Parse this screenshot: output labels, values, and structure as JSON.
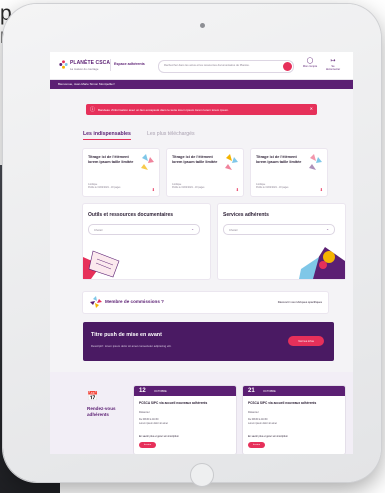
{
  "background_text": [
    "p",
    "n"
  ],
  "header": {
    "brand_name": "PLANÈTE CSCA",
    "brand_tagline": "La maison du courtage",
    "espace_label": "Espace adhérents",
    "search_placeholder": "Rechercher dans les actus et les ressources documentaires de Planète.",
    "account_label": "Mon compte",
    "logout_label": "Se déconnecter"
  },
  "welcome_text": "Bienvenue, Jean-Marie Simon Montpellier!",
  "alert_text": "Bandeau d'information avec un lien encapsulé dans le texte lorem ipsum lorem lorem lorem ipsum.",
  "tabs": [
    "Les indispensables",
    "Les plus téléchargés"
  ],
  "cards": [
    {
      "title": "Titrage ici de l'élément lorem ipsum taille limitée",
      "meta1": "Juridique",
      "meta2": "Publié le 01/02/2021 - 18 pages"
    },
    {
      "title": "Titrage ici de l'élément lorem ipsum taille limitée",
      "meta1": "Juridique",
      "meta2": "Publié le 01/02/2021 - 18 pages"
    },
    {
      "title": "Titrage ici de l'élément lorem ipsum taille limitée",
      "meta1": "Juridique",
      "meta2": "Publié le 01/02/2021 - 18 pages"
    }
  ],
  "panels": [
    {
      "title": "Outils et ressources documentaires",
      "select": "Choisir"
    },
    {
      "title": "Services adhérents",
      "select": "Choisir"
    }
  ],
  "commission": {
    "title": "Membre de commissions ?",
    "link": "Découvrir vos rubriques spécifiques"
  },
  "push": {
    "title": "Titre push de mise en avant",
    "subtitle": "Descriptif : lorem ipsum dolor sit amet consectetur adipiscing elit.",
    "button": "Voir les infos"
  },
  "agenda": {
    "title": "Rendez-vous adhérents"
  },
  "events": [
    {
      "day": "12",
      "month": "OCTOBRE",
      "title": "PCSCA SIPC via accueil nouveaux adhérents",
      "place": "Distanciel",
      "time": "De 09h30 à 11h30",
      "info": "Lorem ipsum dolor sit amet",
      "link": "En savoir plus et gérer son inscription",
      "button": "Inscrire"
    },
    {
      "day": "21",
      "month": "OCTOBRE",
      "title": "PCSCA SIPC via accueil nouveaux adhérents",
      "place": "Distanciel",
      "time": "De 09h30 à 11h30",
      "info": "Lorem ipsum dolor sit amet",
      "link": "En savoir plus et gérer son inscription",
      "button": "Inscrire"
    }
  ],
  "colors": {
    "brand": "#5b1f73",
    "accent": "#e6305a",
    "background": "#f4f3f6"
  }
}
